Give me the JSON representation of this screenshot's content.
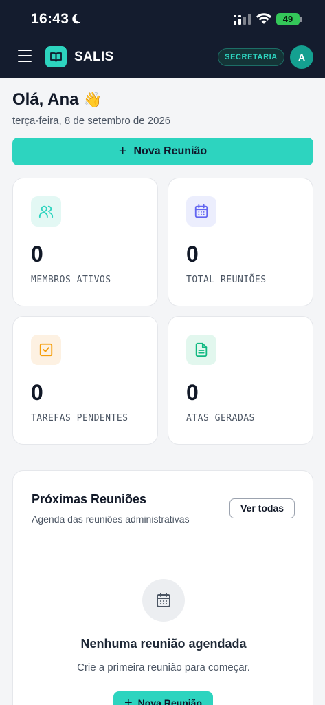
{
  "status_bar": {
    "time": "16:43",
    "battery": "49"
  },
  "header": {
    "brand": "SALIS",
    "role_badge": "SECRETARIA",
    "avatar_initial": "A"
  },
  "greeting": {
    "title": "Olá, Ana",
    "emoji": "👋",
    "date": "terça-feira, 8 de setembro de 2026"
  },
  "primary_action": {
    "plus": "+",
    "label": "Nova Reunião"
  },
  "stats": [
    {
      "value": "0",
      "label": "MEMBROS ATIVOS",
      "icon": "users-icon",
      "color": "#2dd4bf"
    },
    {
      "value": "0",
      "label": "TOTAL REUNIÕES",
      "icon": "calendar-icon",
      "color": "#6366f1"
    },
    {
      "value": "0",
      "label": "TAREFAS PENDENTES",
      "icon": "check-square-icon",
      "color": "#f59e0b"
    },
    {
      "value": "0",
      "label": "ATAS GERADAS",
      "icon": "document-icon",
      "color": "#10b981"
    }
  ],
  "meetings": {
    "title": "Próximas Reuniões",
    "subtitle": "Agenda das reuniões administrativas",
    "view_all": "Ver todas",
    "empty_title": "Nenhuma reunião agendada",
    "empty_subtitle": "Crie a primeira reunião para começar.",
    "create_plus": "+",
    "create_label": "Nova Reunião"
  },
  "colors": {
    "header_bg": "#141c2e",
    "accent": "#2dd4bf",
    "page_bg": "#f4f5f7"
  }
}
